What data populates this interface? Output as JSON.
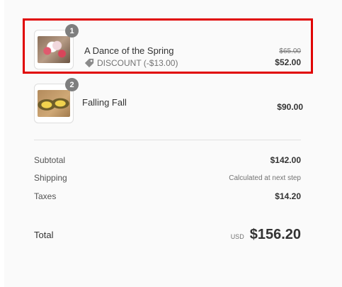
{
  "items": [
    {
      "quantity": "1",
      "name": "A Dance of the Spring",
      "discount": "DISCOUNT (-$13.00)",
      "original_price": "$65.00",
      "price": "$52.00"
    },
    {
      "quantity": "2",
      "name": "Falling Fall",
      "price": "$90.00"
    }
  ],
  "summary": {
    "subtotal_label": "Subtotal",
    "subtotal_value": "$142.00",
    "shipping_label": "Shipping",
    "shipping_value": "Calculated at next step",
    "taxes_label": "Taxes",
    "taxes_value": "$14.20"
  },
  "total": {
    "label": "Total",
    "currency": "USD",
    "amount": "$156.20"
  },
  "colors": {
    "highlight": "#e00000",
    "badge": "#7e7e7e"
  },
  "icons": {
    "discount": "tag-icon"
  }
}
